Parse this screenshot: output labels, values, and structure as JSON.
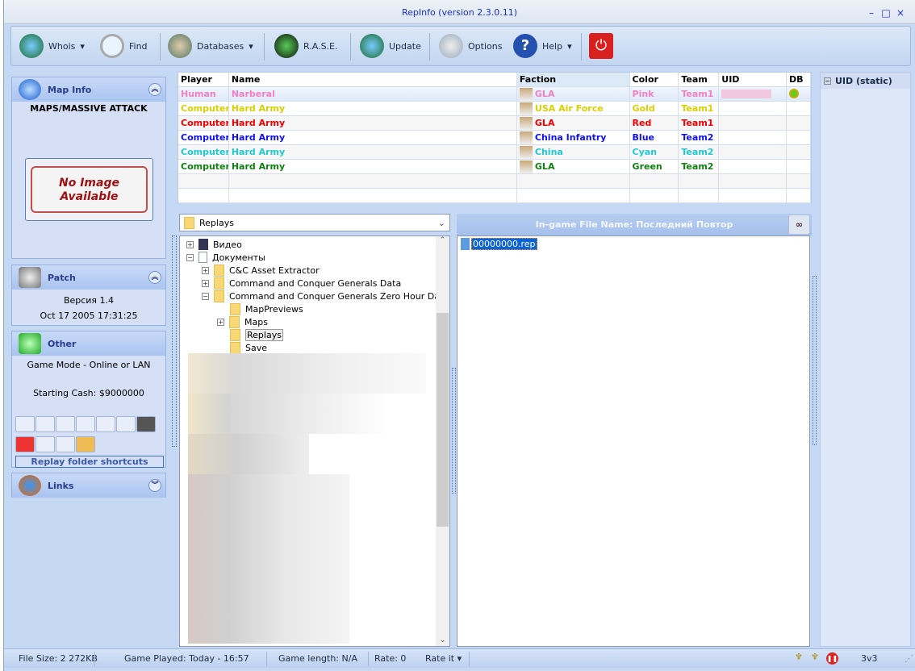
{
  "window": {
    "title": "RepInfo (version 2.3.0.11)",
    "controls": [
      "–",
      "□",
      "×"
    ]
  },
  "toolbar": {
    "whois": "Whois",
    "find": "Find",
    "databases": "Databases",
    "rase": "R.A.S.E.",
    "update": "Update",
    "options": "Options",
    "help": "Help"
  },
  "map_info": {
    "title": "Map Info",
    "map_name": "MAPS/MASSIVE ATTACK",
    "no_image_line1": "No Image",
    "no_image_line2": "Available"
  },
  "patch": {
    "title": "Patch",
    "version": "Версия 1.4",
    "date": "Oct 17 2005 17:31:25"
  },
  "other": {
    "title": "Other",
    "game_mode": "Game Mode - Online or LAN",
    "starting_cash": "Starting Cash: $9000000",
    "shortcuts_label": "Replay folder shortcuts"
  },
  "links": {
    "title": "Links"
  },
  "players_table": {
    "headers": [
      "Player",
      "Name",
      "Faction",
      "Color",
      "Team",
      "UID",
      "DB"
    ],
    "rows": [
      {
        "player": "Human",
        "name": "Narberal",
        "faction": "GLA",
        "color": "Pink",
        "team": "Team1",
        "hex": "#f080c0"
      },
      {
        "player": "Computer",
        "name": "Hard Army",
        "faction": "USA Air Force",
        "color": "Gold",
        "team": "Team1",
        "hex": "#d8d000"
      },
      {
        "player": "Computer",
        "name": "Hard Army",
        "faction": "GLA",
        "color": "Red",
        "team": "Team1",
        "hex": "#f00000"
      },
      {
        "player": "Computer",
        "name": "Hard Army",
        "faction": "China Infantry",
        "color": "Blue",
        "team": "Team2",
        "hex": "#1010f0"
      },
      {
        "player": "Computer",
        "name": "Hard Army",
        "faction": "China",
        "color": "Cyan",
        "team": "Team2",
        "hex": "#20c8d0"
      },
      {
        "player": "Computer",
        "name": "Hard Army",
        "faction": "GLA",
        "color": "Green",
        "team": "Team2",
        "hex": "#108010"
      }
    ]
  },
  "folder_combo": {
    "value": "Replays"
  },
  "tree": [
    "Видео",
    "Документы",
    "C&C Asset Extractor",
    "Command and Conquer Generals Data",
    "Command and Conquer Generals Zero Hour Data",
    "MapPreviews",
    "Maps",
    "Replays",
    "Save"
  ],
  "files_header": "In-game File Name:  Последний Повтор",
  "files": [
    "00000000.rep"
  ],
  "right_panel": {
    "header": "UID (static)"
  },
  "status": {
    "file_size": "File Size: 2 272KB",
    "game_played": "Game Played: Today - 16:57",
    "game_length": "Game length: N/A",
    "rate": "Rate:  0",
    "rate_it": "Rate it",
    "mode": "3v3"
  }
}
